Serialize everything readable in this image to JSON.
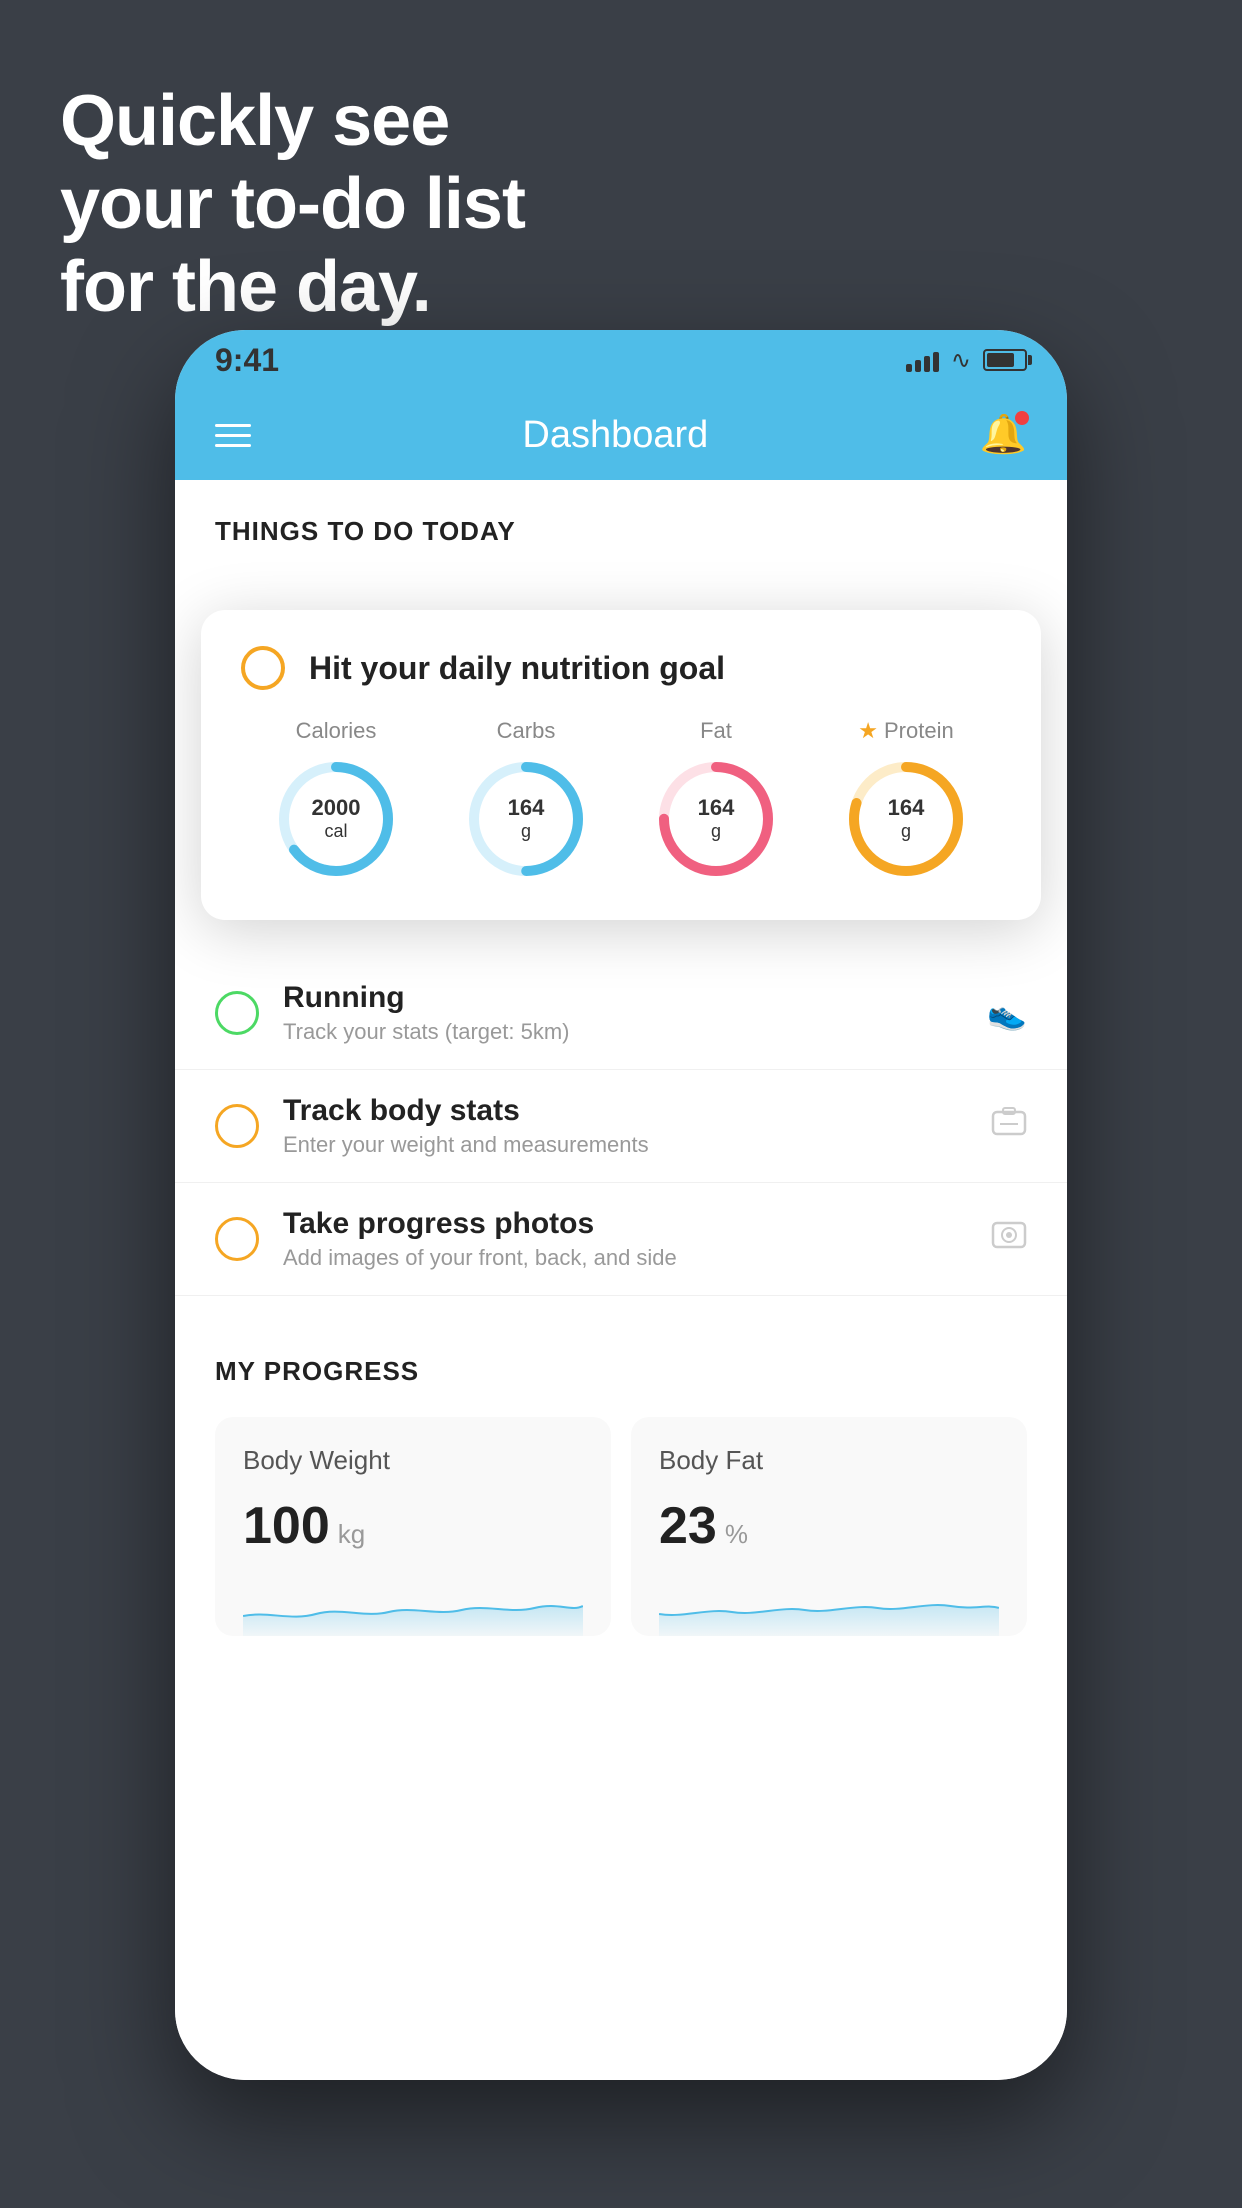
{
  "hero": {
    "line1": "Quickly see",
    "line2": "your to-do list",
    "line3": "for the day."
  },
  "statusBar": {
    "time": "9:41"
  },
  "navBar": {
    "title": "Dashboard"
  },
  "todaySection": {
    "header": "THINGS TO DO TODAY"
  },
  "nutritionCard": {
    "title": "Hit your daily nutrition goal",
    "items": [
      {
        "label": "Calories",
        "value": "2000",
        "unit": "cal",
        "color": "#4fbde8",
        "trackColor": "#d6f0fb",
        "percent": 65
      },
      {
        "label": "Carbs",
        "value": "164",
        "unit": "g",
        "color": "#4fbde8",
        "trackColor": "#d6f0fb",
        "percent": 50
      },
      {
        "label": "Fat",
        "value": "164",
        "unit": "g",
        "color": "#f06080",
        "trackColor": "#fde0e6",
        "percent": 75
      },
      {
        "label": "Protein",
        "value": "164",
        "unit": "g",
        "color": "#f5a623",
        "trackColor": "#fdecc8",
        "percent": 80,
        "star": true
      }
    ]
  },
  "todoItems": [
    {
      "id": "running",
      "title": "Running",
      "subtitle": "Track your stats (target: 5km)",
      "circleColor": "green",
      "icon": "👟"
    },
    {
      "id": "body-stats",
      "title": "Track body stats",
      "subtitle": "Enter your weight and measurements",
      "circleColor": "yellow",
      "icon": "⚖"
    },
    {
      "id": "progress-photos",
      "title": "Take progress photos",
      "subtitle": "Add images of your front, back, and side",
      "circleColor": "yellow",
      "icon": "👤"
    }
  ],
  "progressSection": {
    "header": "MY PROGRESS",
    "cards": [
      {
        "title": "Body Weight",
        "value": "100",
        "unit": "kg"
      },
      {
        "title": "Body Fat",
        "value": "23",
        "unit": "%"
      }
    ]
  }
}
